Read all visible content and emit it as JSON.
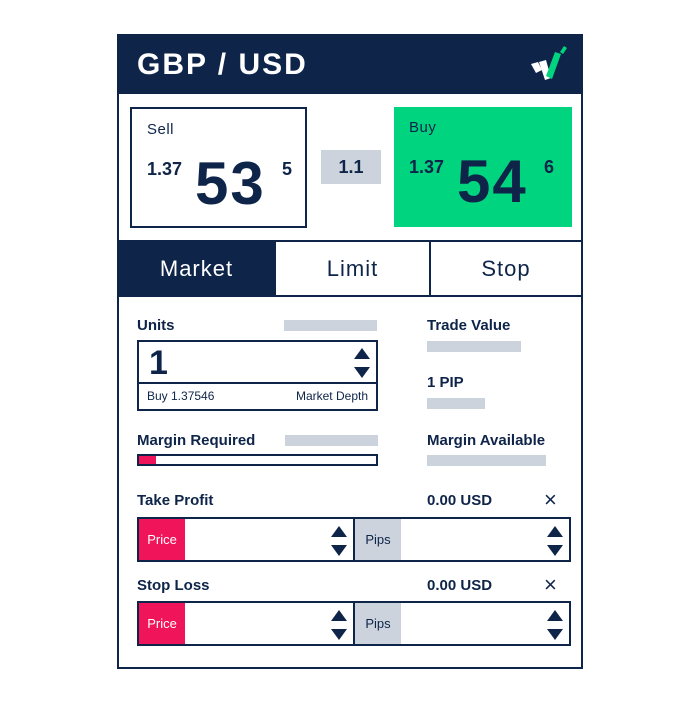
{
  "header": {
    "title": "GBP / USD",
    "logo_icon": "brand-check-logo"
  },
  "quotes": {
    "sell": {
      "label": "Sell",
      "prefix": "1.37",
      "big": "53",
      "pip": "5"
    },
    "buy": {
      "label": "Buy",
      "prefix": "1.37",
      "big": "54",
      "pip": "6"
    },
    "spread": "1.1"
  },
  "tabs": [
    {
      "label": "Market",
      "active": true
    },
    {
      "label": "Limit",
      "active": false
    },
    {
      "label": "Stop",
      "active": false
    }
  ],
  "units": {
    "label": "Units",
    "value": "1",
    "sub_left": "Buy 1.37546",
    "sub_right": "Market Depth"
  },
  "margin_required": {
    "label": "Margin Required",
    "fill_fraction": 0.07
  },
  "info": {
    "trade_value": "Trade Value",
    "pip": "1 PIP",
    "margin_available": "Margin Available"
  },
  "take_profit": {
    "label": "Take Profit",
    "amount": "0.00 USD",
    "close_icon": "×",
    "price_tag": "Price",
    "pips_tag": "Pips"
  },
  "stop_loss": {
    "label": "Stop Loss",
    "amount": "0.00 USD",
    "close_icon": "×",
    "price_tag": "Price",
    "pips_tag": "Pips"
  },
  "colors": {
    "navy": "#0e2449",
    "buy_green": "#00d47e",
    "accent_red": "#f0145a",
    "placeholder_gray": "#ccd3dc"
  }
}
